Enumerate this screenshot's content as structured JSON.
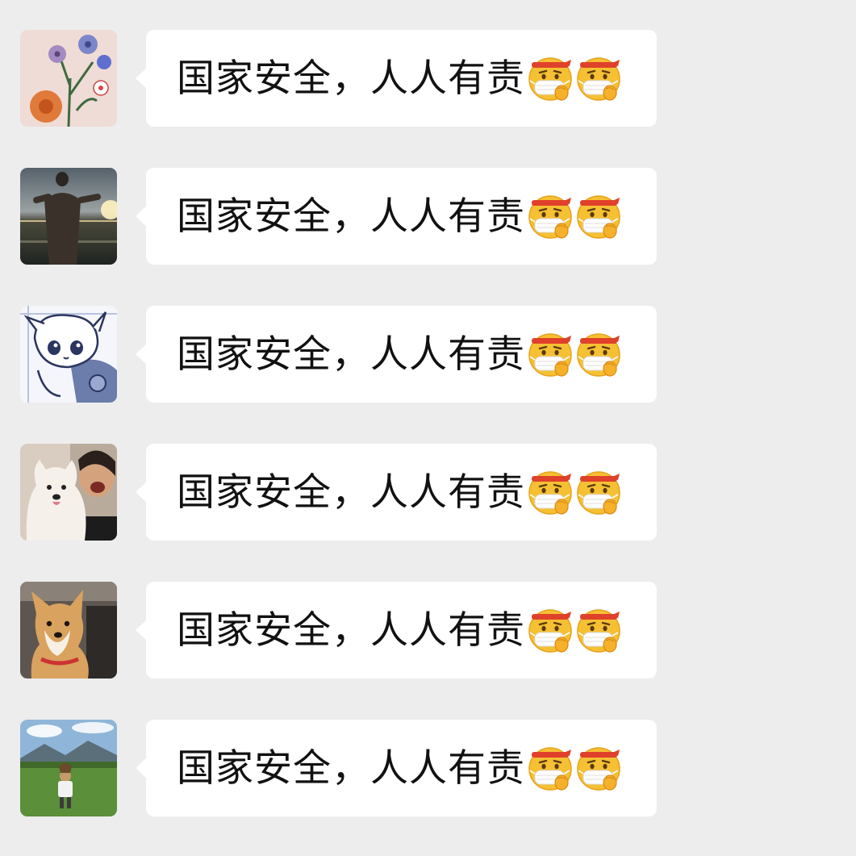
{
  "messages": [
    {
      "text": "国家安全，人人有责",
      "emojis": [
        "face-with-mask-headband-emoji",
        "face-with-mask-headband-emoji"
      ],
      "avatar": "flower-drawing-avatar"
    },
    {
      "text": "国家安全，人人有责",
      "emojis": [
        "face-with-mask-headband-emoji",
        "face-with-mask-headband-emoji"
      ],
      "avatar": "sunset-silhouette-avatar"
    },
    {
      "text": "国家安全，人人有责",
      "emojis": [
        "face-with-mask-headband-emoji",
        "face-with-mask-headband-emoji"
      ],
      "avatar": "anime-sketch-avatar"
    },
    {
      "text": "国家安全，人人有责",
      "emojis": [
        "face-with-mask-headband-emoji",
        "face-with-mask-headband-emoji"
      ],
      "avatar": "samoyed-selfie-avatar"
    },
    {
      "text": "国家安全，人人有责",
      "emojis": [
        "face-with-mask-headband-emoji",
        "face-with-mask-headband-emoji"
      ],
      "avatar": "corgi-photo-avatar"
    },
    {
      "text": "国家安全，人人有责",
      "emojis": [
        "face-with-mask-headband-emoji",
        "face-with-mask-headband-emoji"
      ],
      "avatar": "child-meadow-avatar"
    }
  ],
  "colors": {
    "background": "#ededed",
    "bubble": "#ffffff",
    "text": "#111111",
    "emoji_face": "#f7c23a",
    "emoji_headband": "#e0412b"
  }
}
